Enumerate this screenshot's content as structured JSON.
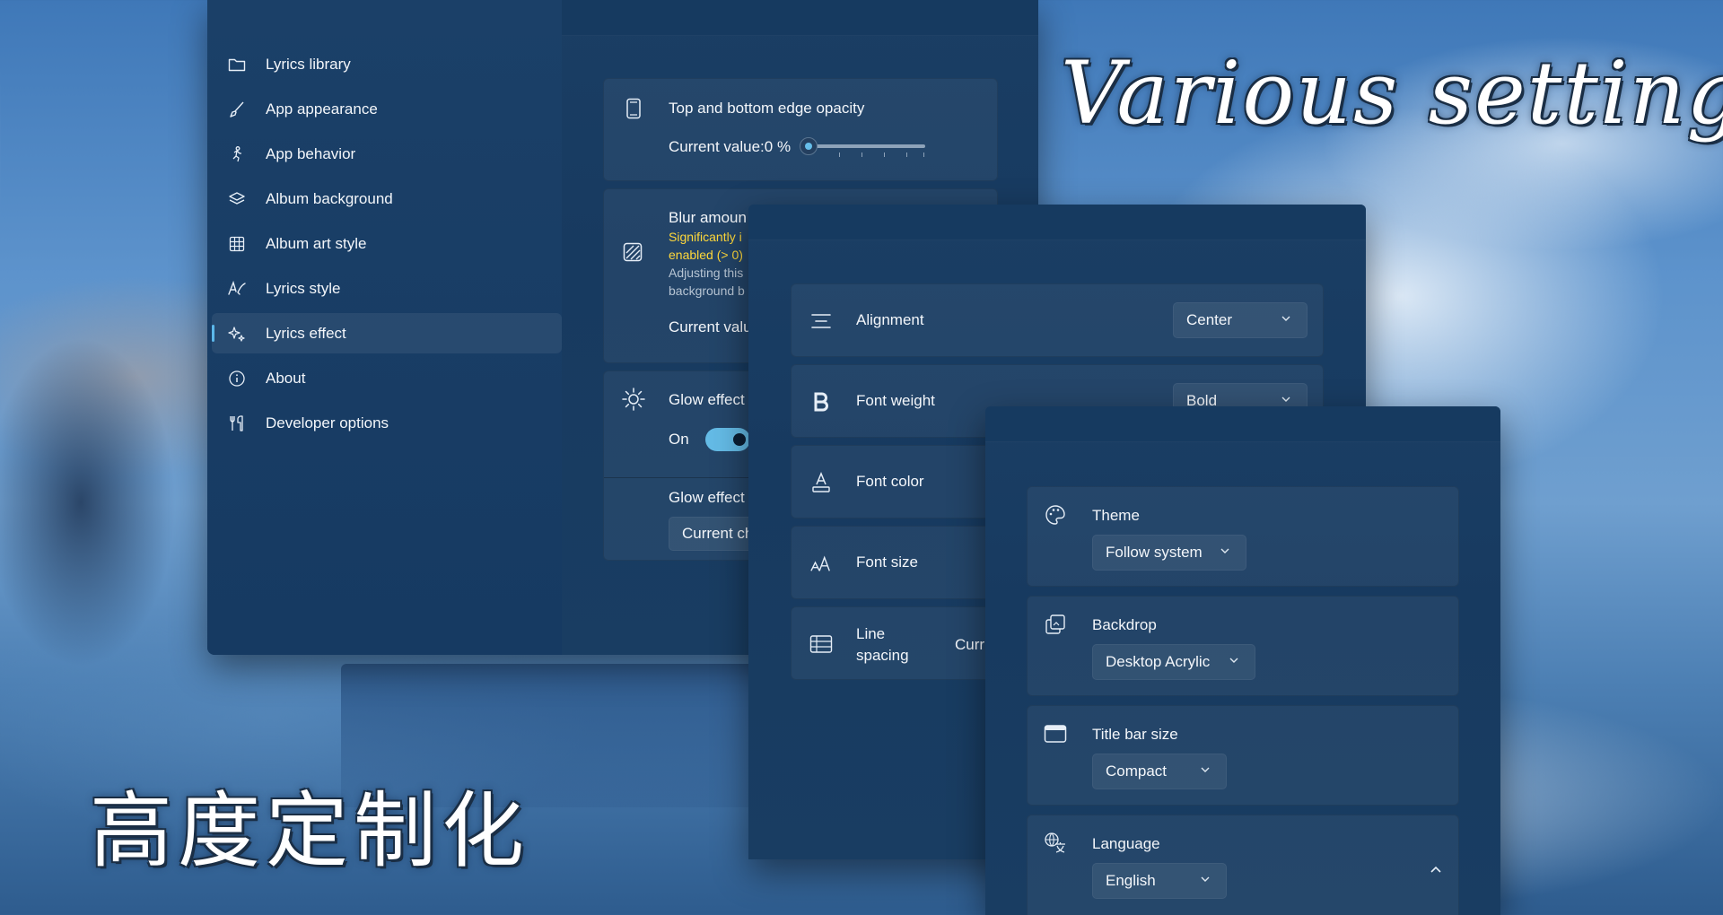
{
  "overlay": {
    "title_en": "Various settings",
    "title_zh": "高度定制化"
  },
  "nav": {
    "items": [
      {
        "label": "Lyrics library",
        "icon": "folder-icon"
      },
      {
        "label": "App appearance",
        "icon": "brush-icon"
      },
      {
        "label": "App behavior",
        "icon": "person-running-icon"
      },
      {
        "label": "Album background",
        "icon": "layers-icon"
      },
      {
        "label": "Album art style",
        "icon": "grid-icon"
      },
      {
        "label": "Lyrics style",
        "icon": "handwriting-icon"
      },
      {
        "label": "Lyrics effect",
        "icon": "sparkle-icon",
        "selected": true
      },
      {
        "label": "About",
        "icon": "info-icon"
      },
      {
        "label": "Developer options",
        "icon": "tools-icon"
      }
    ]
  },
  "effects": {
    "edge_opacity": {
      "title": "Top and bottom edge opacity",
      "value_label": "Current value:0 %",
      "slider_value": 0
    },
    "blur": {
      "title": "Blur amoun",
      "warning_line1": "Significantly i",
      "warning_line2": "enabled (> 0)",
      "desc_line1": "Adjusting this",
      "desc_line2": "background b",
      "value_label": "Current valu"
    },
    "glow": {
      "title": "Glow effect",
      "toggle_label": "On",
      "toggle_on": true
    },
    "glow_sub": {
      "title": "Glow effect",
      "select_value": "Current ch"
    }
  },
  "lyrics_style": {
    "rows": [
      {
        "label": "Alignment",
        "icon": "align-center-icon",
        "value": "Center"
      },
      {
        "label": "Font weight",
        "icon": "bold-icon",
        "value": "Bold"
      },
      {
        "label": "Font color",
        "icon": "font-color-icon",
        "value": ""
      },
      {
        "label": "Font size",
        "icon": "font-size-icon",
        "value": ""
      },
      {
        "label_line1": "Line",
        "label_line2": "spacing",
        "icon": "line-spacing-icon",
        "value": "Curr"
      }
    ]
  },
  "appearance": {
    "theme": {
      "label": "Theme",
      "value": "Follow system",
      "icon": "palette-icon"
    },
    "backdrop": {
      "label": "Backdrop",
      "value": "Desktop Acrylic",
      "icon": "backdrop-icon"
    },
    "titlebar": {
      "label": "Title bar size",
      "value": "Compact",
      "icon": "window-icon"
    },
    "language": {
      "label": "Language",
      "value": "English",
      "icon": "translate-icon"
    }
  },
  "colors": {
    "accent": "#5cb8ea",
    "warning": "#ffd83a",
    "panel": "#1a3e64"
  }
}
